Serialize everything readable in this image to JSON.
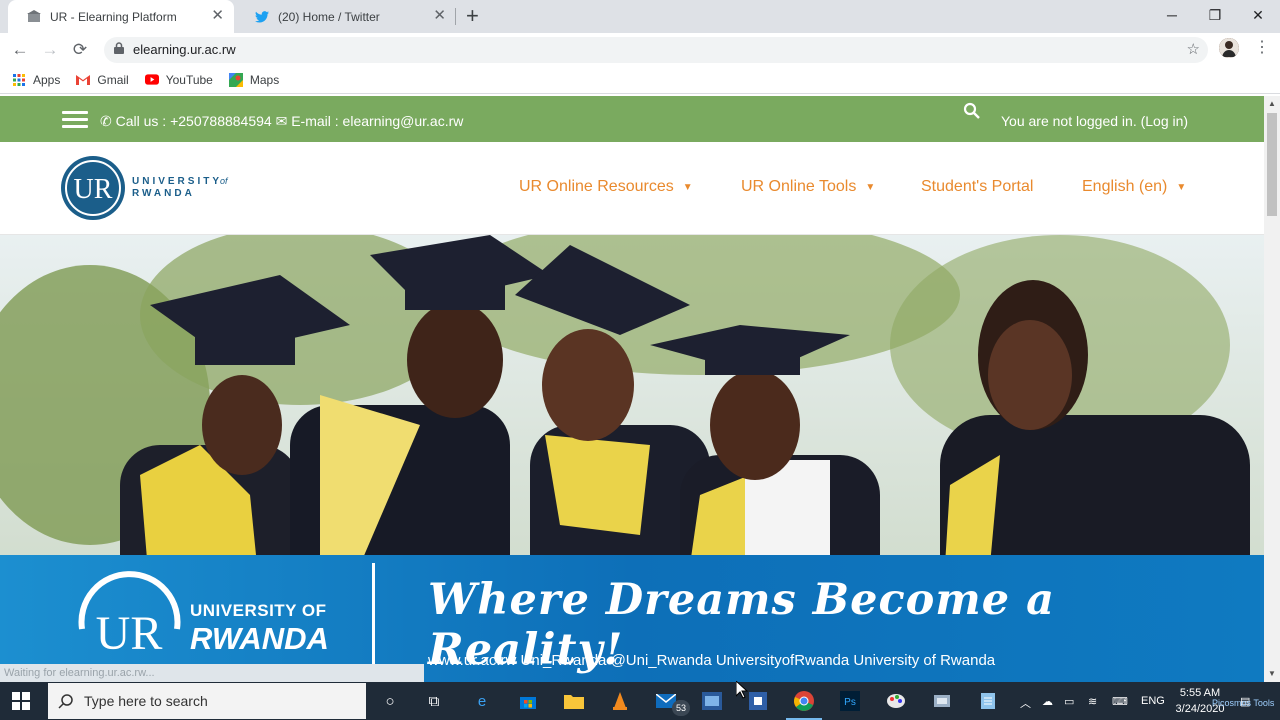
{
  "browser": {
    "tabs": [
      {
        "title": "UR - Elearning Platform",
        "active": true,
        "close": "✕"
      },
      {
        "title": "(20) Home / Twitter",
        "active": false,
        "close": "✕"
      }
    ],
    "new_tab": "+",
    "window_controls": {
      "minimize": "─",
      "maximize": "❐",
      "close": "✕"
    },
    "nav": {
      "back": "←",
      "forward": "→",
      "reload": "⟳"
    },
    "url": "elearning.ur.ac.rw",
    "bookmarks": [
      {
        "label": "Apps",
        "icon": "apps-grid-icon"
      },
      {
        "label": "Gmail",
        "icon": "gmail-icon"
      },
      {
        "label": "YouTube",
        "icon": "youtube-icon"
      },
      {
        "label": "Maps",
        "icon": "maps-icon"
      }
    ],
    "status_text": "Waiting for elearning.ur.ac.rw..."
  },
  "site": {
    "topbar": {
      "call_label": "Call us : +250788884594",
      "email_label": "E-mail : elearning@ur.ac.rw",
      "login_text": "You are not logged in. (Log in)"
    },
    "logo": {
      "line1": "UNIVERSITY",
      "of": "of",
      "line2": "RWANDA"
    },
    "nav": [
      {
        "label": "UR Online Resources",
        "dropdown": true
      },
      {
        "label": "UR Online Tools",
        "dropdown": true
      },
      {
        "label": "Student's Portal",
        "dropdown": false
      },
      {
        "label": "English (en)",
        "dropdown": true
      }
    ],
    "banner": {
      "university_of": "UNIVERSITY OF",
      "rwanda": "RWANDA",
      "slogan": "Where Dreams Become a Reality!",
      "socials": "www.ur.ac.rw  Uni_Rwanda  @Uni_Rwanda  UniversityofRwanda  University of Rwanda"
    }
  },
  "taskbar": {
    "search_placeholder": "Type here to search",
    "mail_badge": "53",
    "lang": "ENG",
    "time": "5:55 AM",
    "date": "3/24/2020",
    "overlay_text": "Picosmos Tools"
  },
  "colors": {
    "topbar_green": "#7aaa5f",
    "nav_orange": "#e98a2e",
    "banner_blue": "#0d6fb8",
    "logo_blue": "#1b5e8a"
  }
}
